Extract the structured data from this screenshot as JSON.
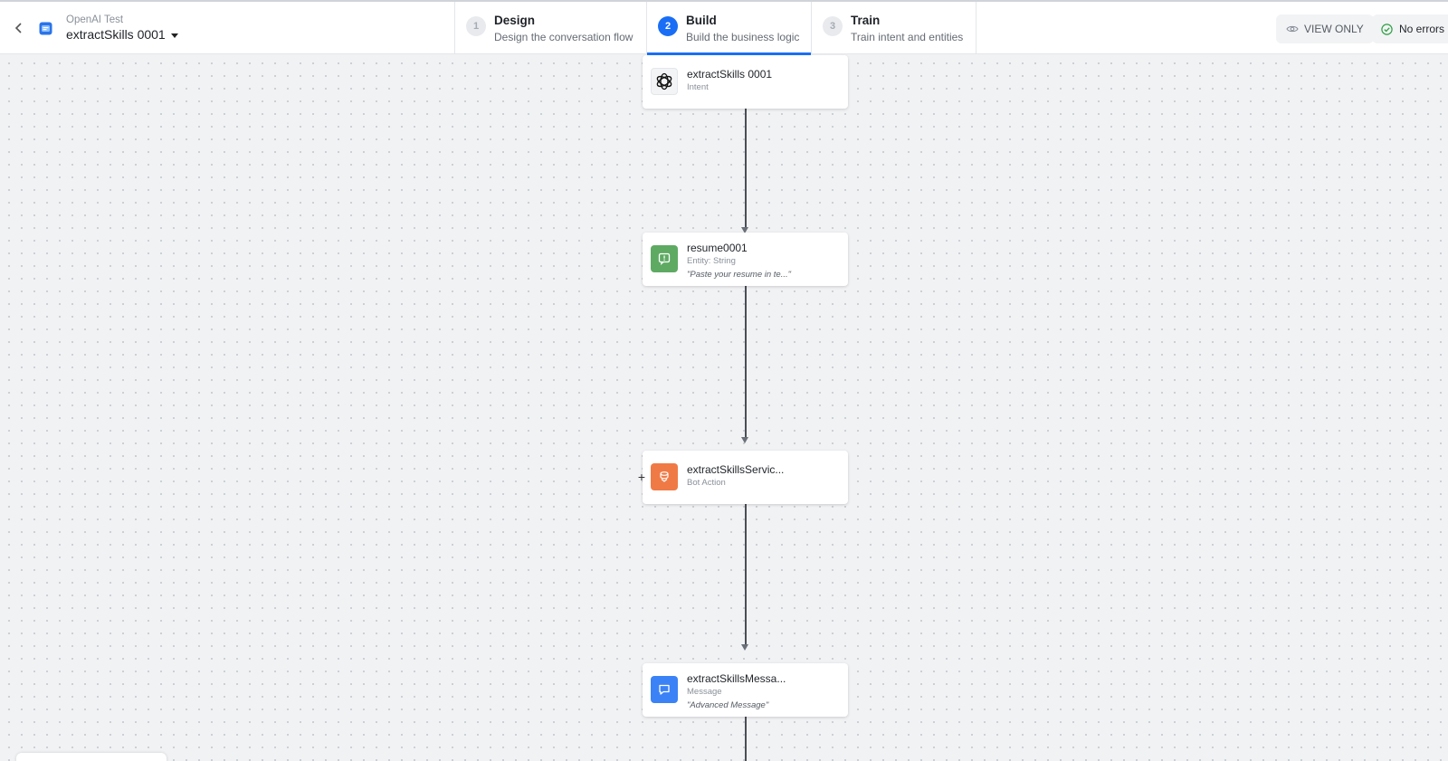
{
  "header": {
    "bot_parent": "OpenAI Test",
    "bot_name": "extractSkills 0001",
    "steps": [
      {
        "num": "1",
        "title": "Design",
        "subtitle": "Design the conversation flow",
        "active": false
      },
      {
        "num": "2",
        "title": "Build",
        "subtitle": "Build the business logic",
        "active": true
      },
      {
        "num": "3",
        "title": "Train",
        "subtitle": "Train intent and entities",
        "active": false
      }
    ],
    "view_only_label": "VIEW ONLY",
    "status_label": "No errors"
  },
  "nodes": [
    {
      "title": "extractSkills 0001",
      "subtitle": "Intent",
      "icon": "openai-icon"
    },
    {
      "title": "resume0001",
      "subtitle": "Entity: String",
      "quote": "\"Paste your resume in te...\"",
      "icon": "entity-prompt-icon",
      "icon_color": "#5eaa63"
    },
    {
      "title": "extractSkillsServic...",
      "subtitle": "Bot Action",
      "icon": "bot-action-icon",
      "icon_color": "#f07a45"
    },
    {
      "title": "extractSkillsMessa...",
      "subtitle": "Message",
      "quote": "\"Advanced Message\"",
      "icon": "message-icon",
      "icon_color": "#3b82f6"
    }
  ],
  "colors": {
    "accent": "#1a6ef5",
    "success": "#2ea043"
  }
}
